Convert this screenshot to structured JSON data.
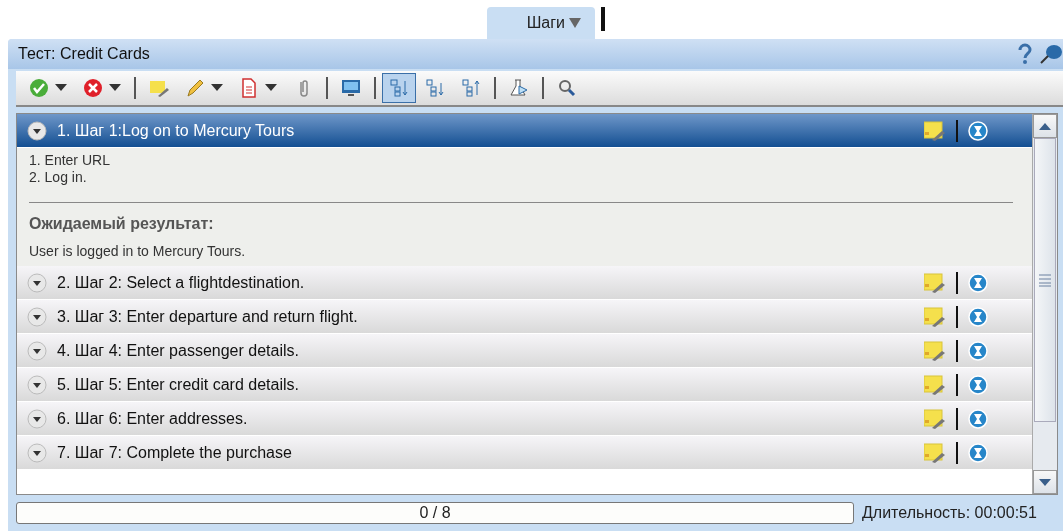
{
  "tab": {
    "label": "Шаги",
    "selected": true
  },
  "panel": {
    "title": "Тест: Credit Cards"
  },
  "toolbar": [
    {
      "kind": "button",
      "dropdown": true,
      "selected": false
    },
    {
      "kind": "button",
      "dropdown": true,
      "selected": false
    },
    {
      "kind": "separator"
    },
    {
      "kind": "button",
      "dropdown": false,
      "selected": false
    },
    {
      "kind": "button",
      "dropdown": true,
      "selected": false
    },
    {
      "kind": "button",
      "dropdown": true,
      "selected": false
    },
    {
      "kind": "button",
      "dropdown": false,
      "selected": false
    },
    {
      "kind": "separator"
    },
    {
      "kind": "button",
      "dropdown": false,
      "selected": false
    },
    {
      "kind": "separator"
    },
    {
      "kind": "button",
      "dropdown": false,
      "selected": true
    },
    {
      "kind": "button",
      "dropdown": false,
      "selected": false
    },
    {
      "kind": "button",
      "dropdown": false,
      "selected": false
    },
    {
      "kind": "separator"
    },
    {
      "kind": "button",
      "dropdown": false,
      "selected": false
    },
    {
      "kind": "separator"
    },
    {
      "kind": "button",
      "dropdown": false,
      "selected": false
    }
  ],
  "steps": [
    {
      "title": "1. Шаг 1:Log on to Mercury Tours",
      "selected": true,
      "description": [
        "1. Enter URL",
        "2. Log in."
      ],
      "expected_label": "Ожидаемый результат:",
      "expected": "User is logged in to Mercury Tours."
    },
    {
      "title": "2. Шаг 2: Select a flightdestination.",
      "selected": false
    },
    {
      "title": "3. Шаг 3: Enter departure and return flight.",
      "selected": false
    },
    {
      "title": "4. Шаг 4: Enter passenger details.",
      "selected": false
    },
    {
      "title": "5. Шаг 5: Enter credit card details.",
      "selected": false
    },
    {
      "title": "6. Шаг 6: Enter addresses.",
      "selected": false
    },
    {
      "title": "7. Шаг 7: Complete the purchase",
      "selected": false
    }
  ],
  "progress": {
    "text": "0 / 8",
    "level": 0
  },
  "duration": "Длительность: 00:00:51"
}
